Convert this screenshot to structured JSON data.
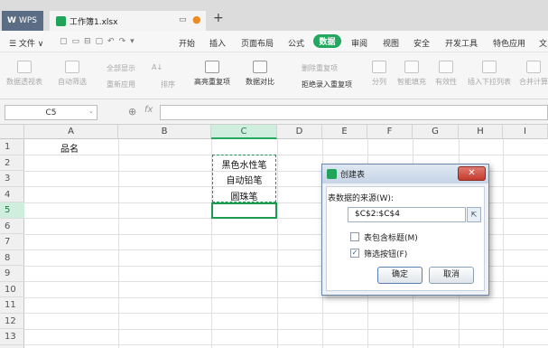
{
  "titlebar": {
    "wps_label": "WPS",
    "doc_tab": "工作簿1.xlsx",
    "new_tab": "+"
  },
  "menu": {
    "items": [
      {
        "label": "☰ 文件 ∨"
      },
      {
        "label": "开始"
      },
      {
        "label": "插入"
      },
      {
        "label": "页面布局"
      },
      {
        "label": "公式"
      },
      {
        "label": "数据"
      },
      {
        "label": "审阅"
      },
      {
        "label": "视图"
      },
      {
        "label": "安全"
      },
      {
        "label": "开发工具"
      },
      {
        "label": "特色应用"
      },
      {
        "label": "文"
      }
    ]
  },
  "ribbon": {
    "pivot": "数据透视表",
    "autofilter": "自动筛选",
    "show_all": "全部显示",
    "reapply": "重新应用",
    "sort": "排序",
    "highlight_dup": "高亮重复项",
    "data_compare": "数据对比",
    "delete_dup": "删除重复项",
    "reject_dup": "拒绝录入重复项",
    "split": "分列",
    "smart_fill": "智能填充",
    "validity": "有效性",
    "insert_dropdown": "插入下拉列表",
    "merge_calc": "合并计算"
  },
  "formula_bar": {
    "name_box": "C5",
    "fx": "fx",
    "value": ""
  },
  "columns": [
    "A",
    "B",
    "C",
    "D",
    "E",
    "F",
    "G",
    "H",
    "I"
  ],
  "selected_column": "C",
  "rows": [
    "1",
    "2",
    "3",
    "4",
    "5",
    "6",
    "7",
    "8",
    "9",
    "10",
    "11",
    "12",
    "13"
  ],
  "selected_row": "5",
  "cells": {
    "A1": "品名",
    "C2": "黑色水性笔",
    "C3": "自动铅笔",
    "C4": "圆珠笔"
  },
  "dialog": {
    "title": "创建表",
    "close": "✕",
    "source_label": "表数据的来源(W):",
    "source_value": "$C$2:$C$4",
    "has_header_label": "表包含标题(M)",
    "has_header_checked": false,
    "filter_label": "筛选按钮(F)",
    "filter_checked": true,
    "ok": "确定",
    "cancel": "取消"
  },
  "colors": {
    "accent": "#22a85f",
    "wps_tab": "#5b6d84"
  }
}
